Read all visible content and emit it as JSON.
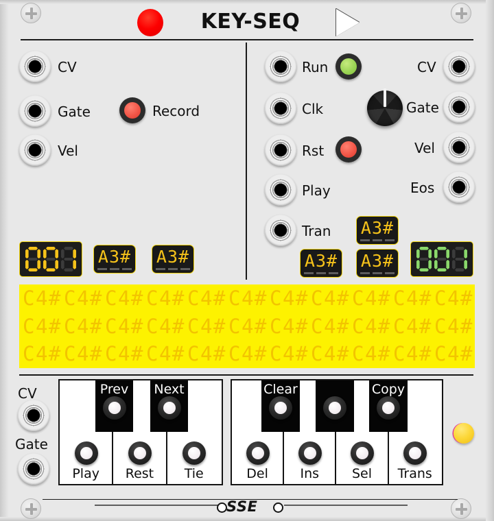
{
  "module": {
    "title": "KEY-SEQ",
    "brand": "SSE",
    "record_icon": "record-dot-icon",
    "play_icon": "play-triangle-icon"
  },
  "input_section": {
    "jacks": [
      {
        "label": "CV"
      },
      {
        "label": "Gate"
      },
      {
        "label": "Vel"
      }
    ],
    "record": {
      "label": "Record",
      "led_color": "#f25648"
    }
  },
  "control_section": {
    "jacks": [
      {
        "label": "Run"
      },
      {
        "label": "Clk"
      },
      {
        "label": "Rst"
      },
      {
        "label": "Play"
      },
      {
        "label": "Tran"
      }
    ],
    "run_led_color": "#9bd455",
    "rst_led_color": "#f25648",
    "knob": {
      "name": "clk-knob"
    }
  },
  "output_section": {
    "jacks": [
      {
        "label": "CV"
      },
      {
        "label": "Gate"
      },
      {
        "label": "Vel"
      },
      {
        "label": "Eos"
      }
    ]
  },
  "displays": {
    "step_counter": {
      "value": "001",
      "color": "#f5c21a"
    },
    "length_counter": {
      "value": "001",
      "color": "#8ad86b"
    },
    "note_left_1": {
      "value": "A3#"
    },
    "note_left_2": {
      "value": "A3#"
    },
    "note_tran": {
      "value": "A3#"
    },
    "note_right_1": {
      "value": "A3#"
    },
    "note_right_2": {
      "value": "A3#"
    }
  },
  "matrix": {
    "background": "#fdf200",
    "text_color": "#f2c400",
    "rows": [
      [
        "C4#",
        "C4#",
        "C4#",
        "C4#",
        "C4#",
        "C4#",
        "C4#",
        "C4#",
        "C4#",
        "C4#",
        "C4#"
      ],
      [
        "C4#",
        "C4#",
        "C4#",
        "C4#",
        "C4#",
        "C4#",
        "C4#",
        "C4#",
        "C4#",
        "C4#",
        "C4#"
      ],
      [
        "C4#",
        "C4#",
        "C4#",
        "C4#",
        "C4#",
        "C4#",
        "C4#",
        "C4#",
        "C4#",
        "C4#",
        "C4#"
      ]
    ]
  },
  "bottom_jacks": [
    {
      "label": "CV"
    },
    {
      "label": "Gate"
    }
  ],
  "keyboard": {
    "group_left": {
      "white_keys": [
        {
          "label": "Play"
        },
        {
          "label": "Rest"
        },
        {
          "label": "Tie"
        }
      ],
      "black_keys": [
        {
          "label": "Prev"
        },
        {
          "label": "Next"
        }
      ]
    },
    "group_right": {
      "white_keys": [
        {
          "label": "Del"
        },
        {
          "label": "Ins"
        },
        {
          "label": "Sel"
        },
        {
          "label": "Trans"
        }
      ],
      "black_keys": [
        {
          "label": "Clear"
        },
        {
          "label": ""
        },
        {
          "label": "Copy"
        }
      ]
    }
  },
  "indicator_lamp": {
    "color": "#fcd635"
  }
}
